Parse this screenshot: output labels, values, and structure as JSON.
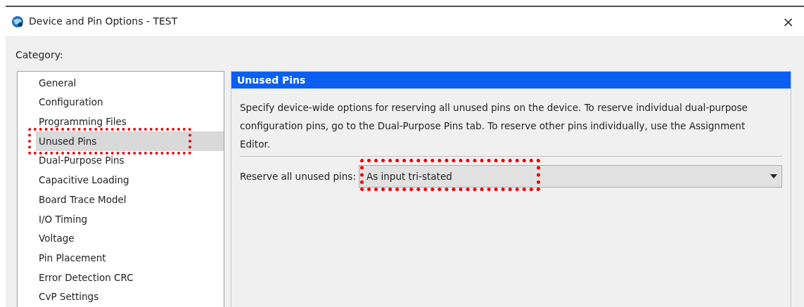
{
  "window": {
    "title": "Device and Pin Options - TEST",
    "close": "×"
  },
  "category_label": "Category:",
  "categories": [
    {
      "label": "General",
      "selected": false
    },
    {
      "label": "Configuration",
      "selected": false
    },
    {
      "label": "Programming Files",
      "selected": false
    },
    {
      "label": "Unused Pins",
      "selected": true,
      "highlighted": true
    },
    {
      "label": "Dual-Purpose Pins",
      "selected": false
    },
    {
      "label": "Capacitive Loading",
      "selected": false
    },
    {
      "label": "Board Trace Model",
      "selected": false
    },
    {
      "label": "I/O Timing",
      "selected": false
    },
    {
      "label": "Voltage",
      "selected": false
    },
    {
      "label": "Pin Placement",
      "selected": false
    },
    {
      "label": "Error Detection CRC",
      "selected": false
    },
    {
      "label": "CvP Settings",
      "selected": false
    }
  ],
  "panel": {
    "title": "Unused Pins",
    "description": "Specify device-wide options for reserving all unused pins on the device. To reserve individual dual-purpose configuration pins, go to the Dual-Purpose Pins tab. To reserve other pins individually, use the Assignment Editor.",
    "field_label": "Reserve all unused pins:",
    "dropdown": {
      "value": "As input tri-stated",
      "highlighted": true
    }
  }
}
